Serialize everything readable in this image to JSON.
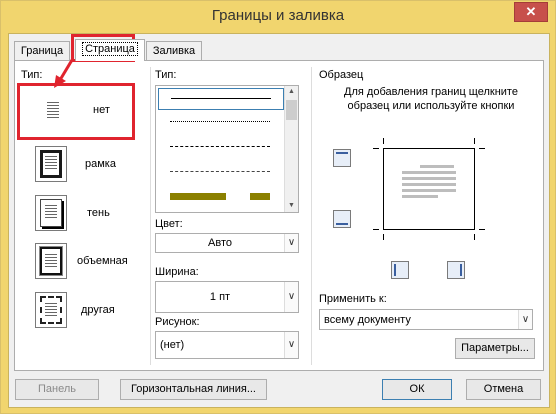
{
  "window": {
    "title": "Границы и заливка",
    "close_glyph": "✕"
  },
  "tabs": [
    {
      "label": "Граница"
    },
    {
      "label": "Страница"
    },
    {
      "label": "Заливка"
    }
  ],
  "type_section": {
    "label": "Тип:",
    "options": [
      {
        "label": "нет",
        "selected": true
      },
      {
        "label": "рамка"
      },
      {
        "label": "тень"
      },
      {
        "label": "объемная"
      },
      {
        "label": "другая"
      }
    ]
  },
  "line_type": {
    "label": "Тип:",
    "scroll_up": "▲",
    "scroll_down": "▼"
  },
  "color": {
    "label": "Цвет:",
    "value": "Авто",
    "line_color": "#8b8000"
  },
  "width": {
    "label": "Ширина:",
    "value": "1 пт"
  },
  "art": {
    "label": "Рисунок:",
    "value": "(нет)"
  },
  "preview": {
    "label": "Образец",
    "hint": "Для добавления границ щелкните образец или используйте кнопки"
  },
  "apply_to": {
    "label": "Применить к:",
    "value": "всему документу"
  },
  "buttons": {
    "options": "Параметры...",
    "panel": "Панель",
    "horizontal_line": "Горизонтальная линия...",
    "ok": "ОК",
    "cancel": "Отмена"
  },
  "dropdown_glyph": "∨",
  "annotation_color": "#e0242e"
}
